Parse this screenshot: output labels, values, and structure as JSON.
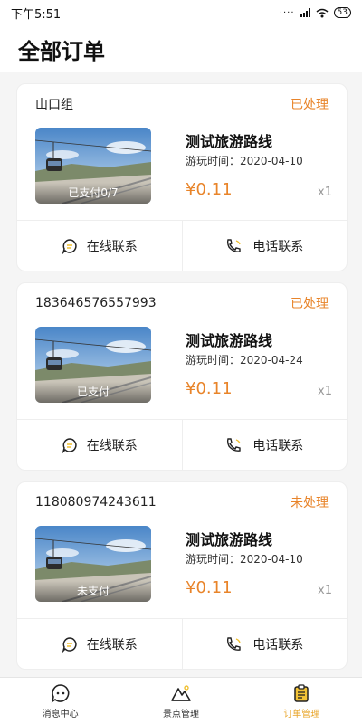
{
  "status_bar": {
    "time": "下午5:51",
    "battery": "53"
  },
  "header": {
    "title": "全部订单"
  },
  "orders": [
    {
      "id": "山口组",
      "status": "已处理",
      "title": "测试旅游路线",
      "time_label": "游玩时间：2020-04-10",
      "price": "¥0.11",
      "qty": "x1",
      "pay_tag": "已支付0/7"
    },
    {
      "id": "183646576557993",
      "status": "已处理",
      "title": "测试旅游路线",
      "time_label": "游玩时间：2020-04-24",
      "price": "¥0.11",
      "qty": "x1",
      "pay_tag": "已支付"
    },
    {
      "id": "118080974243611",
      "status": "未处理",
      "title": "测试旅游路线",
      "time_label": "游玩时间：2020-04-10",
      "price": "¥0.11",
      "qty": "x1",
      "pay_tag": "未支付"
    }
  ],
  "actions": {
    "online": "在线联系",
    "phone": "电话联系"
  },
  "tabbar": {
    "messages": "消息中心",
    "scenic": "景点管理",
    "orders": "订单管理",
    "active": "orders"
  },
  "colors": {
    "accent": "#e8842a",
    "tab_active": "#e8a52a"
  }
}
